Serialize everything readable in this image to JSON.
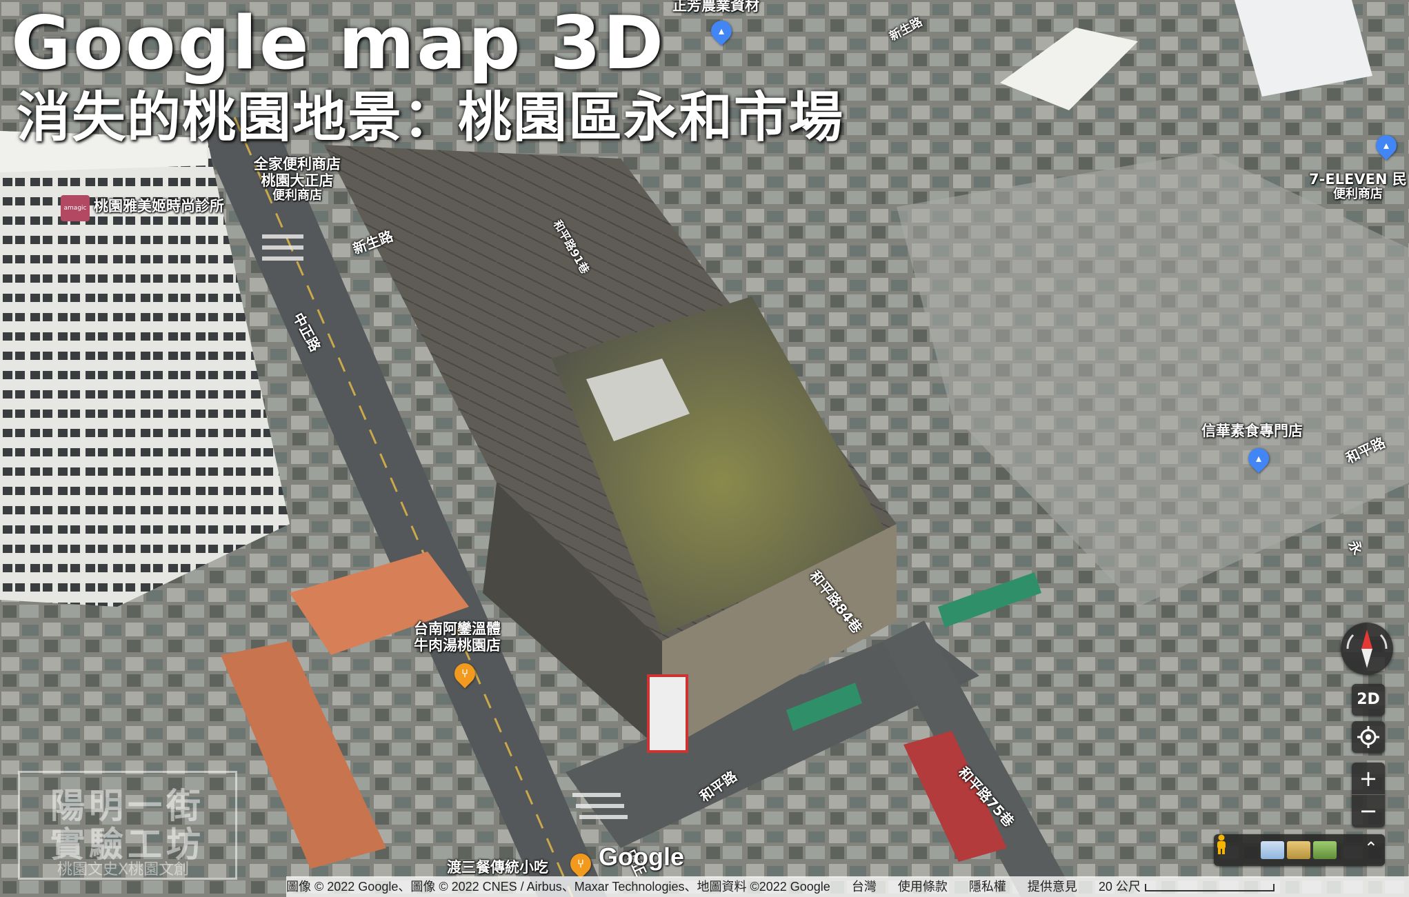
{
  "title": {
    "en": "Google map 3D",
    "zh": "消失的桃園地景：桃園區永和市場"
  },
  "places": {
    "top_store": "正芳農業資材",
    "familymart": [
      "全家便利商店",
      "桃園大正店",
      "便利商店"
    ],
    "clinic": "桃園雅美姬時尚診所",
    "clinic_badge": "amagic",
    "seven_eleven": [
      "7-ELEVEN 民",
      "便利商店"
    ],
    "vegetarian": "信華素食專門店",
    "beef_soup": [
      "台南阿鑾溫體",
      "牛肉湯桃園店"
    ],
    "snack": "渡三餐傳統小吃"
  },
  "streets": {
    "xinsheng_top": "新生路",
    "xinsheng_left": "新生路",
    "zhongzheng_left": "中正路",
    "zhongzheng_bottom": "中正",
    "heping": "和平路",
    "heping_84": "和平路84巷",
    "heping_75": "和平路75巷",
    "heping_right": "和平路",
    "heping_lane_small": "和平路91巷",
    "yong_right": "永"
  },
  "controls": {
    "mode_2d": "2D",
    "zoom_in": "+",
    "zoom_out": "−",
    "locate_icon": "target-icon",
    "layers_chevron": "⌃"
  },
  "google_logo": "Google",
  "attribution": {
    "imagery": "圖像 © 2022 Google、圖像 © 2022 CNES / Airbus、Maxar Technologies、地圖資料 ©2022 Google",
    "region": "台灣",
    "terms": "使用條款",
    "privacy": "隱私權",
    "feedback": "提供意見",
    "scale": "20 公尺"
  },
  "watermark": {
    "line1": "陽明一街",
    "line2": "實驗工坊",
    "sub": "桃園文史X桃園文創"
  },
  "colors": {
    "pin_blue": "#4285f4",
    "pin_orange": "#f29a1e",
    "compass_red": "#e53935"
  }
}
